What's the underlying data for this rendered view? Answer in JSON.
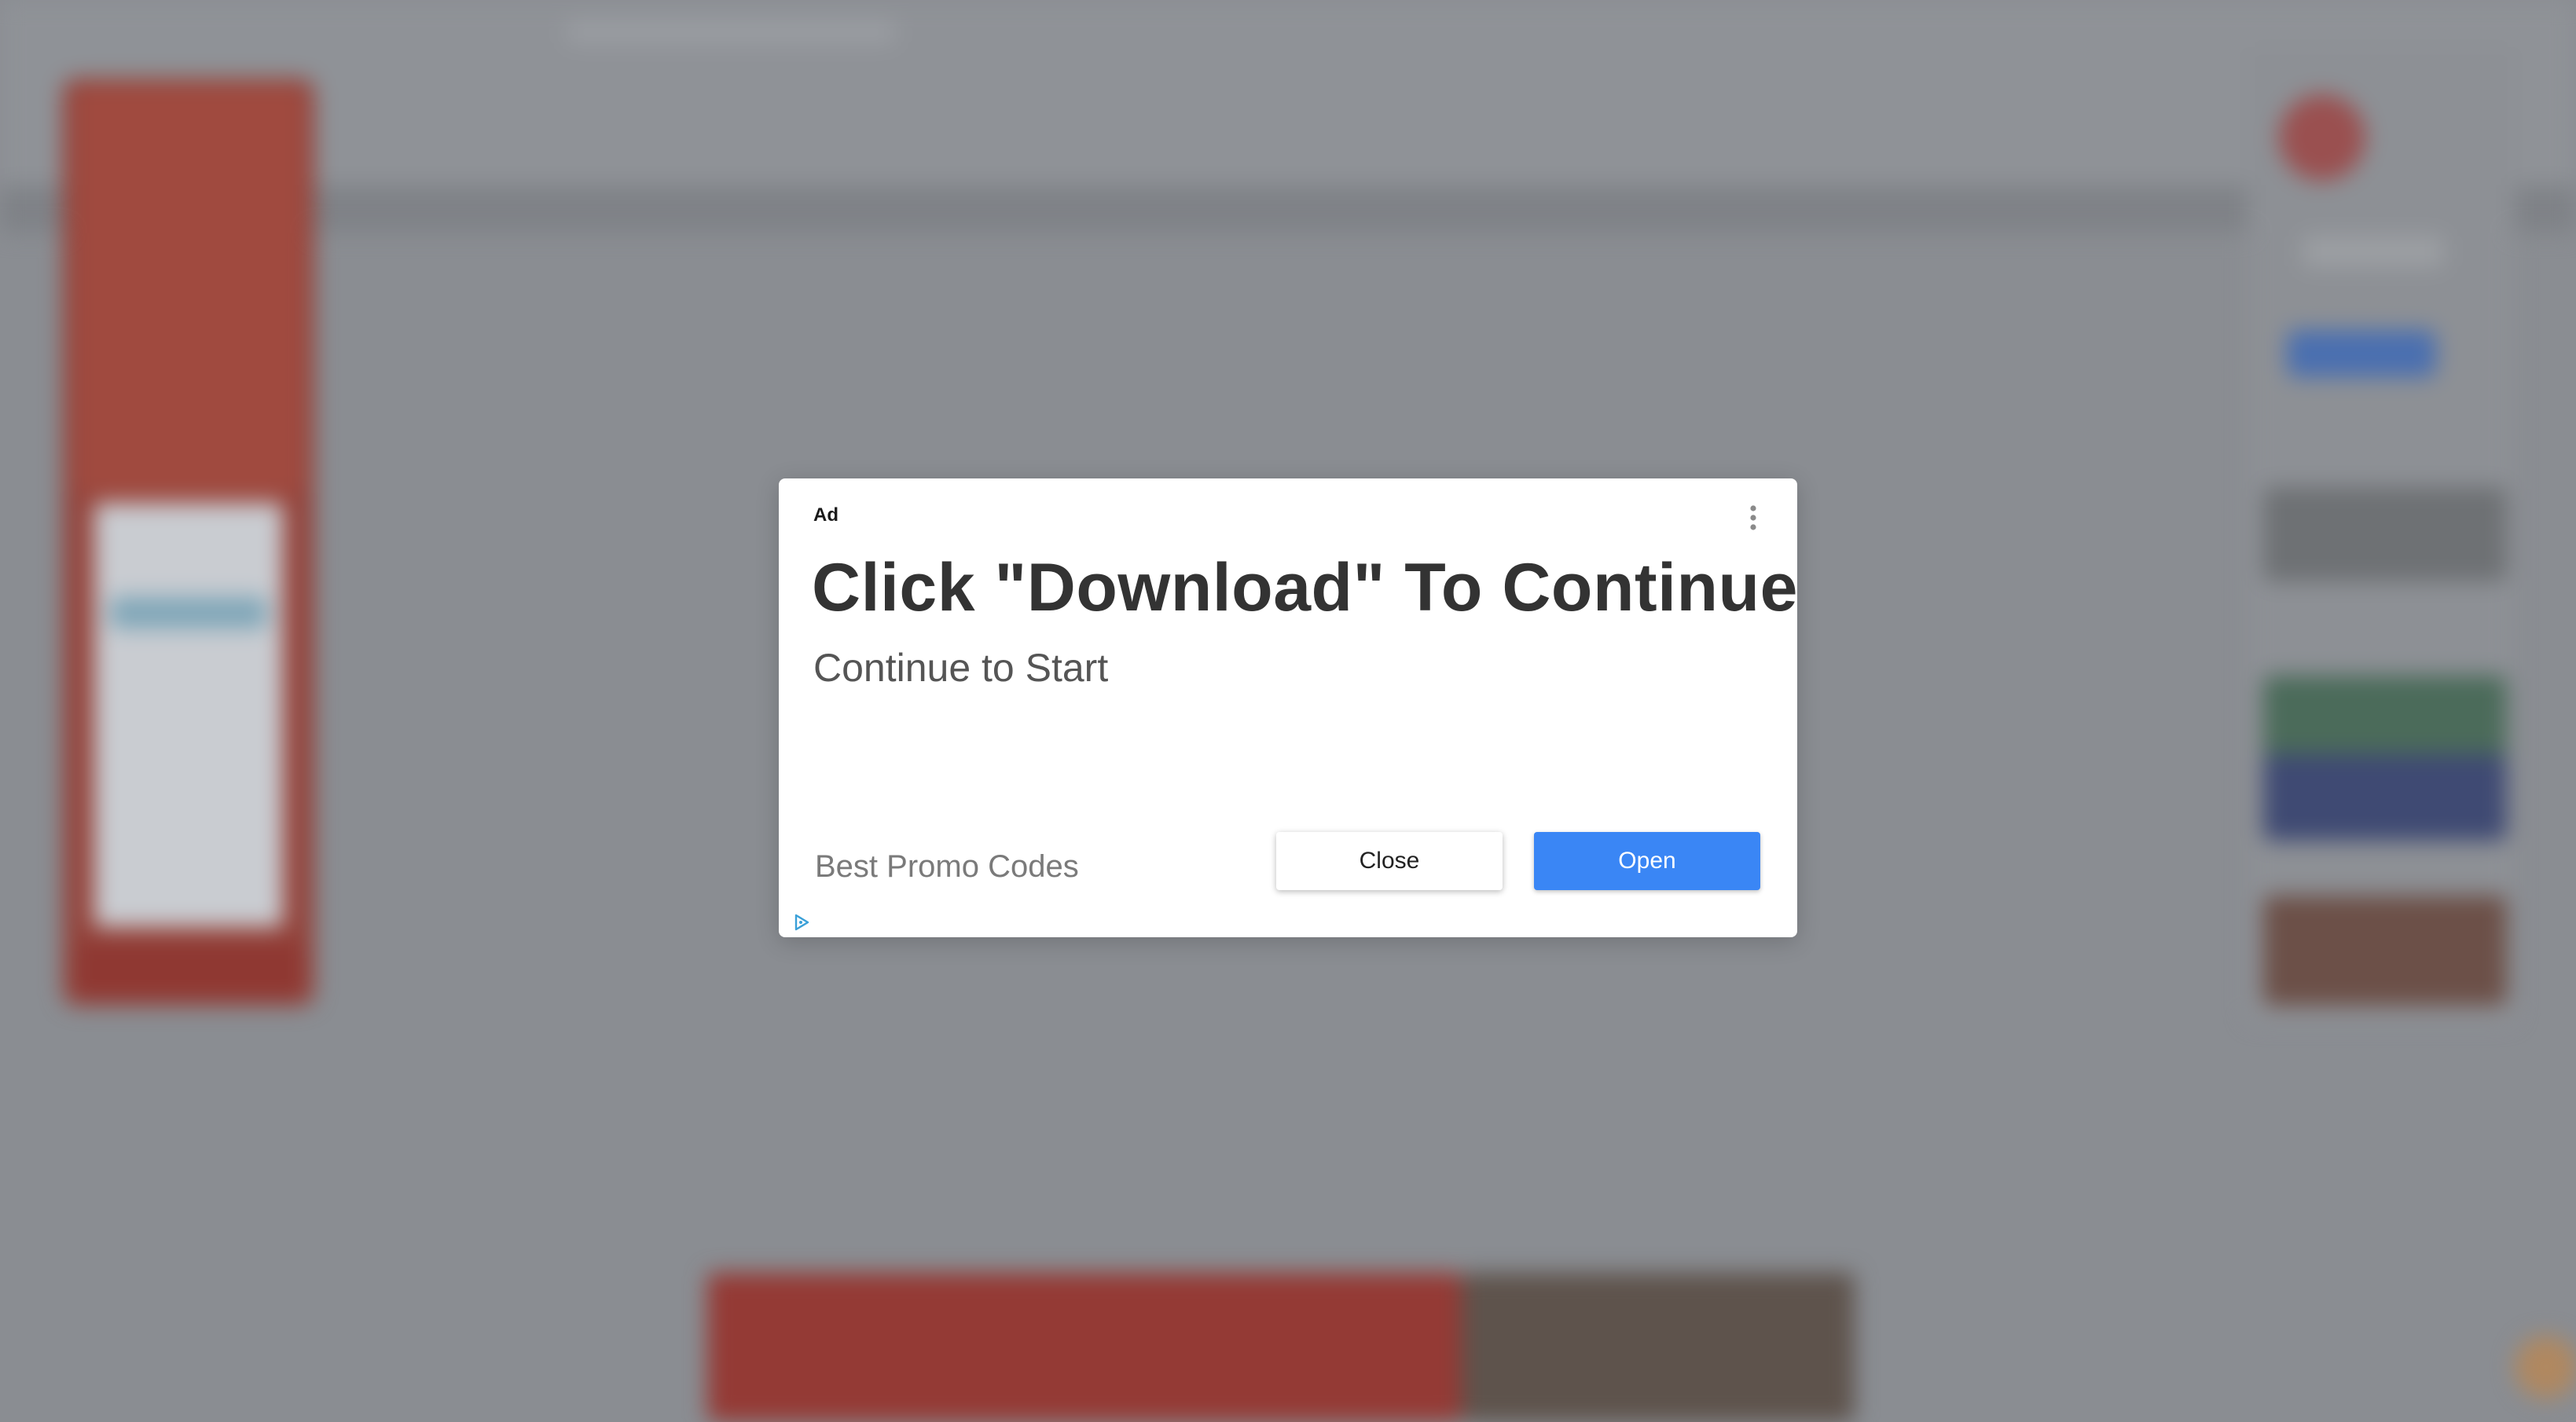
{
  "ad": {
    "label": "Ad",
    "headline": "Click \"Download\" To Continue",
    "subtitle": "Continue to Start",
    "advertiser": "Best Promo Codes",
    "close_label": "Close",
    "open_label": "Open",
    "open_color": "#3a86f5"
  },
  "icons": {
    "menu": "more-vertical-icon",
    "adchoices": "adchoices-icon"
  }
}
